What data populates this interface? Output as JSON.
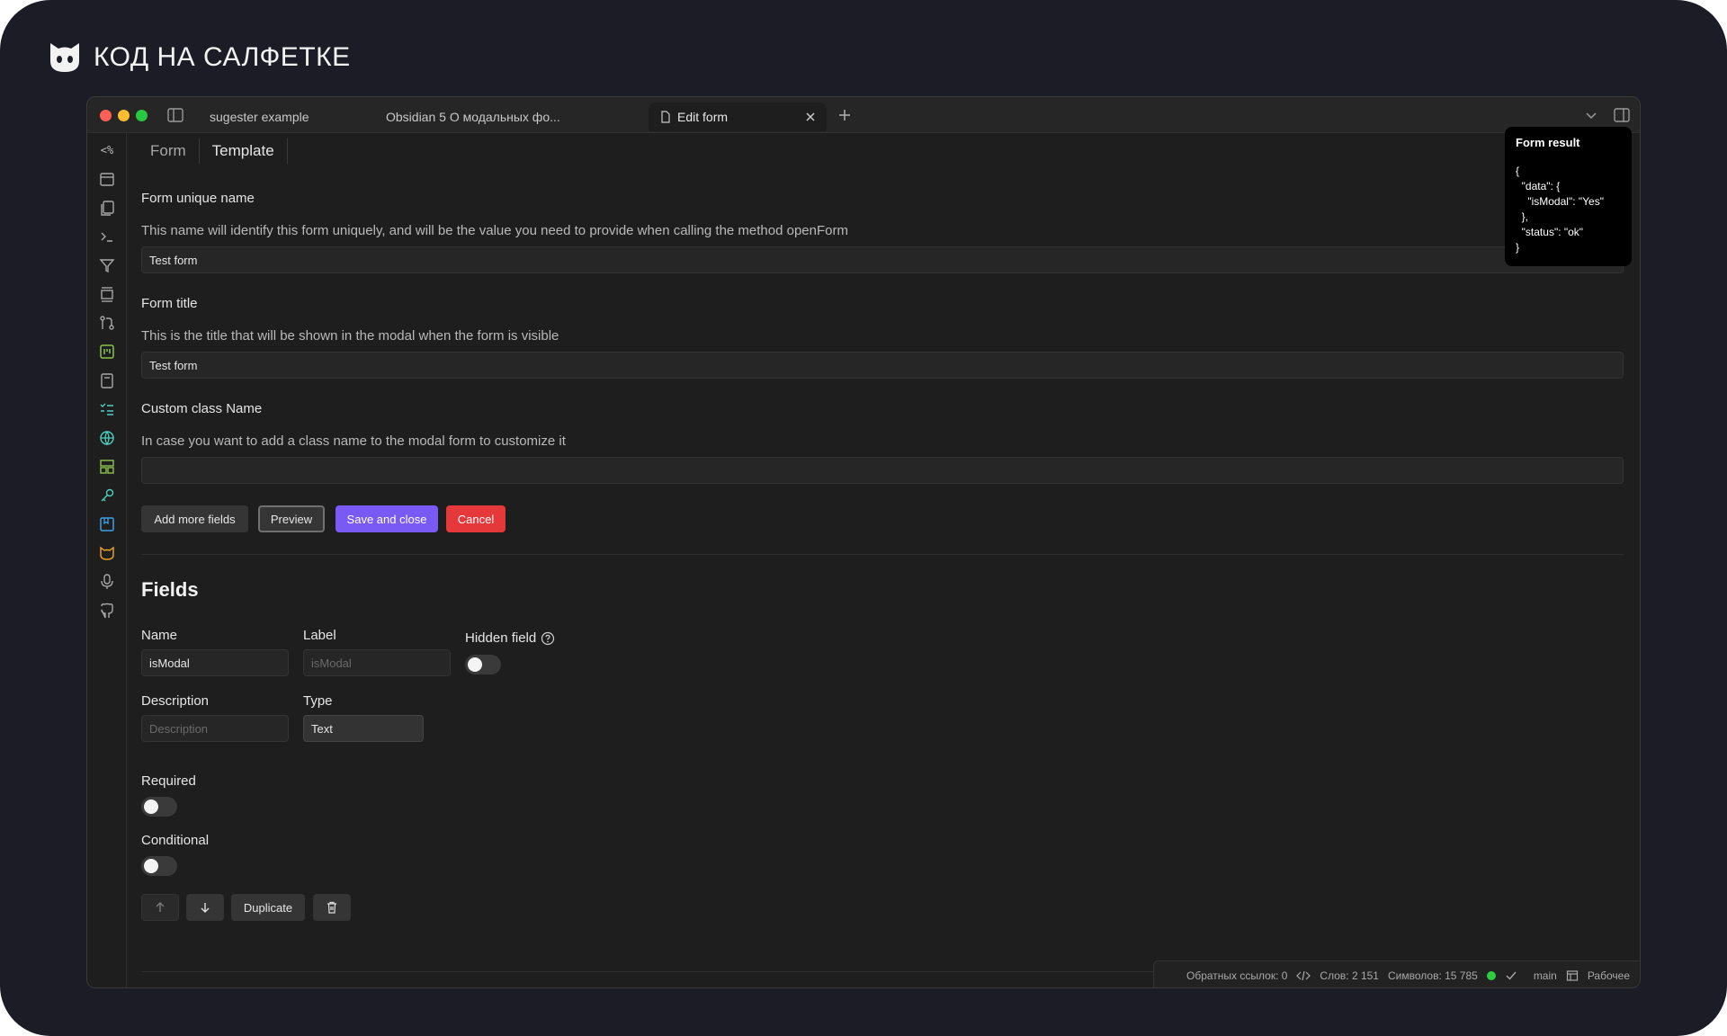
{
  "brand": {
    "text": "КОД НА САЛФЕТКЕ",
    "icon": "cat-logo-icon"
  },
  "window": {
    "tabs": [
      {
        "label": "sugester example"
      },
      {
        "label": "Obsidian 5 О модальных фо..."
      },
      {
        "label": "Edit form",
        "active": true
      }
    ]
  },
  "ribbon": {
    "template_label": "<%",
    "icons": [
      "templater-icon",
      "calendar-icon",
      "files-icon",
      "terminal-icon",
      "filter-icon",
      "layers-icon",
      "git-icon",
      "kanban-icon",
      "book-icon",
      "tasks-icon",
      "globe-icon",
      "layout-icon",
      "key-icon",
      "bookmark-icon",
      "cat-icon",
      "mic-icon",
      "github-icon"
    ]
  },
  "subtabs": {
    "form": "Form",
    "template": "Template"
  },
  "form": {
    "unique_name": {
      "label": "Form unique name",
      "description": "This name will identify this form uniquely, and will be the value you need to provide when calling the method openForm",
      "value": "Test form"
    },
    "title": {
      "label": "Form title",
      "description": "This is the title that will be shown in the modal when the form is visible",
      "value": "Test form"
    },
    "custom_class": {
      "label": "Custom class Name",
      "description": "In case you want to add a class name to the modal form to customize it",
      "value": ""
    },
    "buttons": {
      "add_more": "Add more fields",
      "preview": "Preview",
      "save": "Save and close",
      "cancel": "Cancel"
    }
  },
  "fields": {
    "title": "Fields",
    "name_label": "Name",
    "name_value": "isModal",
    "label_label": "Label",
    "label_placeholder": "isModal",
    "hidden_label": "Hidden field",
    "description_label": "Description",
    "description_placeholder": "Description",
    "type_label": "Type",
    "type_value": "Text",
    "required_label": "Required",
    "conditional_label": "Conditional",
    "duplicate": "Duplicate"
  },
  "popup": {
    "title": "Form result",
    "json": "{\n  \"data\": {\n    \"isModal\": \"Yes\"\n  },\n  \"status\": \"ok\"\n}"
  },
  "status": {
    "backlinks": "Обратных ссылок: 0",
    "words": "Слов: 2 151",
    "chars": "Символов: 15 785",
    "branch": "main",
    "workspace": "Рабочее"
  },
  "colors": {
    "accent": "#7a5af5",
    "danger": "#e5383b",
    "sync": "#2ecc40"
  }
}
